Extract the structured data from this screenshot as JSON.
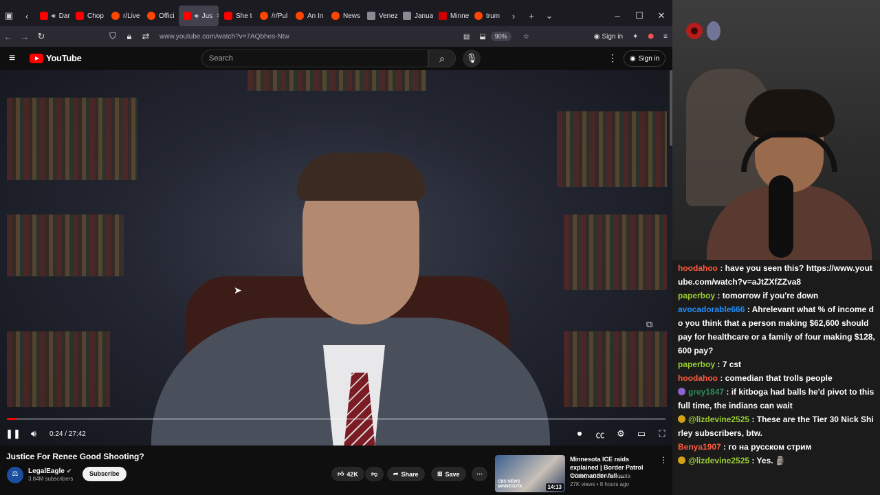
{
  "browser": {
    "tabs": [
      {
        "label": "Dark S",
        "favicon": "yt",
        "audio": true
      },
      {
        "label": "Chop",
        "favicon": "yt"
      },
      {
        "label": "r/Live",
        "favicon": "reddit"
      },
      {
        "label": "Offici",
        "favicon": "reddit"
      },
      {
        "label": "Jus",
        "favicon": "yt",
        "audio": true,
        "active": true
      },
      {
        "label": "She t",
        "favicon": "yt"
      },
      {
        "label": "/r/Pul",
        "favicon": "reddit"
      },
      {
        "label": "An In",
        "favicon": "reddit"
      },
      {
        "label": "News",
        "favicon": "reddit"
      },
      {
        "label": "Venez",
        "favicon": "gray"
      },
      {
        "label": "Janua",
        "favicon": "gray"
      },
      {
        "label": "Minne",
        "favicon": "cnn"
      },
      {
        "label": "trum",
        "favicon": "reddit"
      }
    ],
    "url": "www.youtube.com/watch?v=7AQbhes-Ntw",
    "zoom": "90%",
    "signin_label": "Sign in"
  },
  "youtube": {
    "logo_text": "YouTube",
    "search_placeholder": "Search",
    "signin_label": "Sign in",
    "player": {
      "time": "0:24 / 27:42",
      "progress": 0.0145
    },
    "video_title": "Justice For Renee Good Shooting?",
    "channel": {
      "name": "LegalEagle",
      "subscribers": "3.84M subscribers",
      "subscribe_label": "Subscribe"
    },
    "actions": {
      "likes": "42K",
      "share_label": "Share",
      "save_label": "Save"
    },
    "recommendation": {
      "title": "Minnesota ICE raids explained | Border Patrol Commander full ...",
      "channel": "WCCO - CBS Minnesota",
      "meta": "27K views • 8 hours ago",
      "duration": "14:13",
      "thumb_text": "CBS NEWS MINNESOTA"
    }
  },
  "stream": {
    "chat": [
      {
        "user": "hoodahoo",
        "color": "#ff5a3c",
        "text": "have you seen this? https://www.youtube.com/watch?v=aJtZXfZZva8"
      },
      {
        "user": "paperboy",
        "color": "#9acd32",
        "text": "tomorrow if you're down"
      },
      {
        "user": "avocadorable666",
        "color": "#1e90ff",
        "text": "Ahrelevant what % of income do you think that a person making $62,600 should pay for healthcare or a family of four making $128,600 pay?"
      },
      {
        "user": "paperboy",
        "color": "#9acd32",
        "text": "7 cst"
      },
      {
        "user": "hoodahoo",
        "color": "#ff5a3c",
        "text": "comedian that trolls people"
      },
      {
        "user": "grey1847",
        "color": "#2e8b57",
        "text": "if kitboga had balls he'd pivot to this full time, the indians can wait",
        "badge": "#8a63d2"
      },
      {
        "user": "@lizdevine2525",
        "color": "#9acd32",
        "text": "These are the Tier 30 Nick Shirley subscribers, btw.",
        "badge": "#d4a017"
      },
      {
        "user": "Benya1907",
        "color": "#ff5a3c",
        "text": "го на русском стрим"
      },
      {
        "user": "@lizdevine2525",
        "color": "#9acd32",
        "text": "Yes. 🗿",
        "badge": "#d4a017"
      }
    ]
  }
}
